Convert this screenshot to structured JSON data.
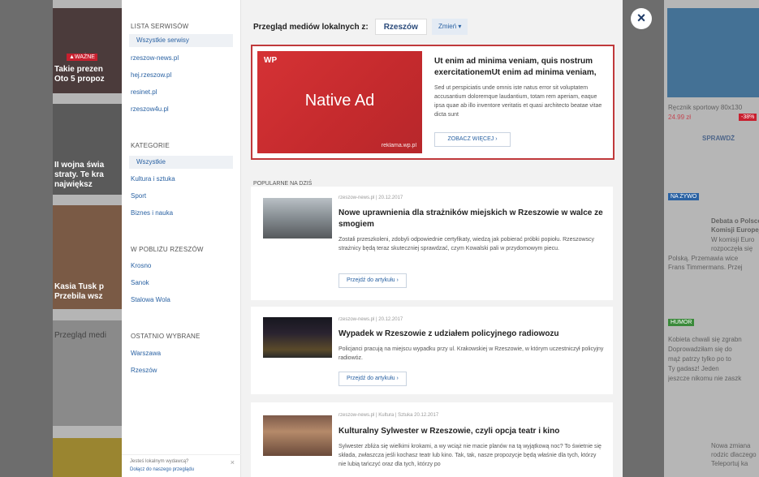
{
  "background_page": {
    "tag": "▲WAŻNE",
    "caption_1a": "Takie prezen",
    "caption_1b": "Oto 5 propoz",
    "caption_2a": "II wojna świa",
    "caption_2b": "straty. Te kra",
    "caption_2c": "największ",
    "caption_3a": "Kasia Tusk p",
    "caption_3b": "Przebila wsz",
    "caption_4": "Przegląd medi",
    "right_product": "Ręcznik sportowy 80x130",
    "right_price": "24.99 zł",
    "right_discount": "-38%",
    "right_check": "SPRAWDŹ",
    "right_badge_1": "NA ŻYWO",
    "right_text_1": "Debata o Polsce",
    "right_text_2": "Komisji Europejs",
    "right_text_3": "W komisji Euro",
    "right_text_4": "rozpoczęła się",
    "right_text_5": "Polską. Przemawia wice",
    "right_text_6": "Frans Timmermans. Przej",
    "right_badge_2": "HUMOR",
    "right_text_7": "Kobieta chwali się zgrabn",
    "right_text_8": "Doprowadziłam się do",
    "right_text_9": "mąż patrzy tylko po to",
    "right_text_10": "Ty gadasz! Jeden",
    "right_text_11": "jeszcze nikomu nie zaszk",
    "right_text_12": "Nowa zmiana",
    "right_text_13": "rodzic dlaczego",
    "right_text_14": "Teleportuj ka"
  },
  "close_label": "×",
  "sidebar": {
    "services_heading": "LISTA SERWISÓW",
    "services": [
      "Wszystkie serwisy",
      "rzeszow-news.pl",
      "hej.rzeszow.pl",
      "resinet.pl",
      "rzeszow4u.pl"
    ],
    "categories_heading": "KATEGORIE",
    "categories": [
      "Wszystkie",
      "Kultura i sztuka",
      "Sport",
      "Biznes i nauka"
    ],
    "nearby_heading": "W POBLIŻU RZESZÓW",
    "nearby": [
      "Krosno",
      "Sanok",
      "Stalowa Wola"
    ],
    "recent_heading": "OSTATNIO WYBRANE",
    "recent": [
      "Warszawa",
      "Rzeszów"
    ],
    "footer_question": "Jesteś lokalnym wydawcą?",
    "footer_link": "Dołącz do naszego przeglądu",
    "footer_close": "×"
  },
  "header": {
    "label": "Przegląd mediów lokalnych z:",
    "city": "Rzeszów",
    "change": "Zmień ▾"
  },
  "ad": {
    "logo": "WP",
    "image_label": "Native Ad",
    "image_url": "reklama.wp.pl",
    "title": "Ut enim ad minima veniam, quis nostrum exercitationemUt enim ad minima veniam,",
    "body": "Sed ut perspiciatis unde omnis iste natus error sit voluptatem accusantium doloremque laudantium, totam rem aperiam, eaque ipsa quae ab illo inventore veritatis et quasi architecto beatae vitae dicta sunt",
    "button": "ZOBACZ WIĘCEJ  ›"
  },
  "popular_heading": "POPULARNE NA DZIŚ",
  "articles": [
    {
      "meta": "rzeszow-news.pl  |  20.12.2017",
      "title": "Nowe uprawnienia dla strażników miejskich w Rzeszowie w walce ze smogiem",
      "desc": "Zostali przeszkoleni, zdobyli odpowiednie certyfikaty, wiedzą jak pobierać próbki popiołu. Rzeszowscy strażnicy będą teraz skuteczniej sprawdzać, czym Kowalski pali w przydomowym piecu.",
      "button": "Przejdź do artykułu  ›"
    },
    {
      "meta": "rzeszow-news.pl  |  20.12.2017",
      "title": "Wypadek w Rzeszowie z udziałem policyjnego radiowozu",
      "desc": "Policjanci pracują na miejscu wypadku przy ul. Krakowskiej w Rzeszowie, w którym uczestniczył policyjny radiowóz.",
      "button": "Przejdź do artykułu  ›"
    },
    {
      "meta": "rzeszow-news.pl  |  Kultura | Sztuka 20.12.2017",
      "title": "Kulturalny Sylwester w Rzeszowie, czyli opcja teatr i kino",
      "desc": "Sylwester zbliża się wielkimi krokami, a wy wciąż nie macie planów na tą wyjątkową noc? To świetnie się składa, zwłaszcza jeśli kochasz teatr lub kino. Tak, tak, nasze propozycje będą właśnie dla tych, którzy nie lubią tańczyć oraz dla tych, którzy po"
    }
  ]
}
